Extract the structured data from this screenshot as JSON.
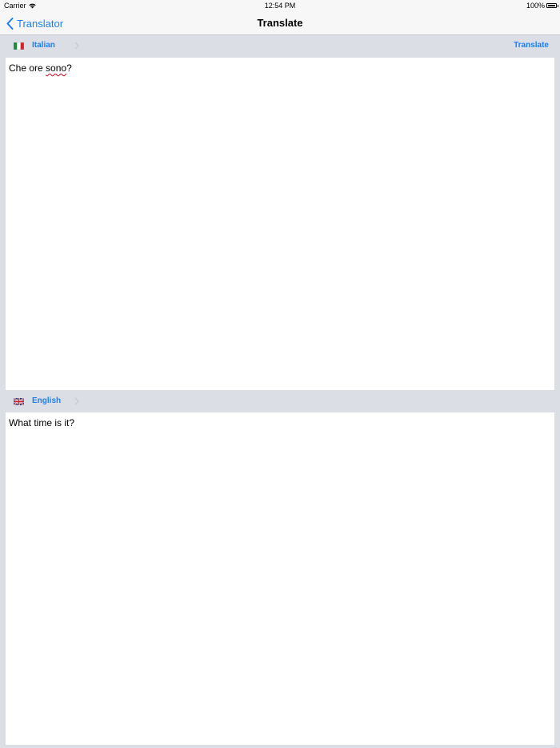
{
  "status_bar": {
    "carrier": "Carrier",
    "time": "12:54 PM",
    "battery": "100%"
  },
  "nav": {
    "back_label": "Translator",
    "title": "Translate"
  },
  "source": {
    "language": "Italian",
    "flag": "italy-flag",
    "translate_label": "Translate",
    "text_part1": "Che ore ",
    "text_misspelled": "sono",
    "text_part2": "?"
  },
  "target": {
    "language": "English",
    "flag": "uk-flag",
    "text": "What time is it?"
  },
  "colors": {
    "accent": "#1d7ff5",
    "background": "#dbdee5",
    "bar": "#f7f7f8"
  }
}
